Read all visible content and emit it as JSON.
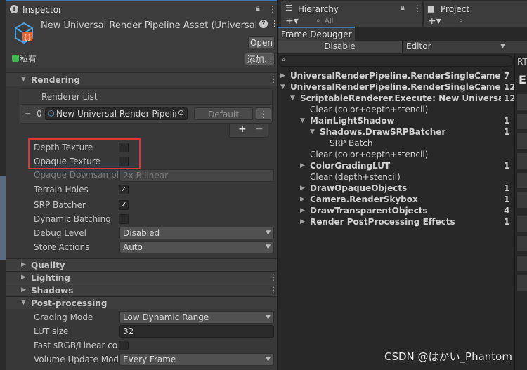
{
  "inspector": {
    "tab_label": "Inspector",
    "asset_title": "New Universal Render Pipeline Asset (Universal",
    "open_button": "Open",
    "private_label": "私有",
    "add_button": "添加...",
    "rendering": {
      "header": "Rendering",
      "renderer_list_label": "Renderer List",
      "renderer_index": "0",
      "renderer_value": "New Universal Render Pipeline",
      "default_button": "Default",
      "plus": "+",
      "minus": "−",
      "rows": [
        {
          "label": "Depth Texture",
          "type": "checkbox",
          "checked": false
        },
        {
          "label": "Opaque Texture",
          "type": "checkbox",
          "checked": false
        },
        {
          "label": "Opaque Downsampli",
          "type": "dropdown-disabled",
          "value": "2x Bilinear"
        },
        {
          "label": "Terrain Holes",
          "type": "checkbox",
          "checked": true
        },
        {
          "label": "SRP Batcher",
          "type": "checkbox",
          "checked": true
        },
        {
          "label": "Dynamic Batching",
          "type": "checkbox",
          "checked": false
        },
        {
          "label": "Debug Level",
          "type": "dropdown",
          "value": "Disabled"
        },
        {
          "label": "Store Actions",
          "type": "dropdown",
          "value": "Auto"
        }
      ]
    },
    "sections": [
      "Quality",
      "Lighting",
      "Shadows"
    ],
    "post": {
      "header": "Post-processing",
      "grading_label": "Grading Mode",
      "grading_value": "Low Dynamic Range",
      "lut_label": "LUT size",
      "lut_value": "32",
      "fast_label": "Fast sRGB/Linear cor",
      "volume_label": "Volume Update Mode",
      "volume_value": "Every Frame"
    }
  },
  "hierarchy": {
    "tab_label": "Hierarchy",
    "search_placeholder": "All"
  },
  "project": {
    "tab_label": "Project"
  },
  "frame_debugger": {
    "tab_label": "Frame Debugger",
    "disable_button": "Disable",
    "target_value": "Editor",
    "rt_label": "RT",
    "tree": [
      {
        "text": "UniversalRenderPipeline.RenderSingleCameraIntern",
        "count": "7",
        "indent": 0,
        "toggle": "▶",
        "bold": true
      },
      {
        "text": "UniversalRenderPipeline.RenderSingleCameraIntern",
        "count": "12",
        "indent": 0,
        "toggle": "▼",
        "bold": true
      },
      {
        "text": "ScriptableRenderer.Execute: New Universal Rend",
        "count": "12",
        "indent": 1,
        "toggle": "▼",
        "bold": true
      },
      {
        "text": "Clear (color+depth+stencil)",
        "count": "",
        "indent": 2,
        "toggle": "",
        "bold": false
      },
      {
        "text": "MainLightShadow",
        "count": "1",
        "indent": 2,
        "toggle": "▼",
        "bold": true
      },
      {
        "text": "Shadows.DrawSRPBatcher",
        "count": "1",
        "indent": 3,
        "toggle": "▼",
        "bold": true
      },
      {
        "text": "SRP Batch",
        "count": "",
        "indent": 4,
        "toggle": "",
        "bold": false
      },
      {
        "text": "Clear (color+depth+stencil)",
        "count": "",
        "indent": 2,
        "toggle": "",
        "bold": false
      },
      {
        "text": "ColorGradingLUT",
        "count": "1",
        "indent": 2,
        "toggle": "▶",
        "bold": true
      },
      {
        "text": "Clear (depth+stencil)",
        "count": "",
        "indent": 2,
        "toggle": "",
        "bold": false
      },
      {
        "text": "DrawOpaqueObjects",
        "count": "1",
        "indent": 2,
        "toggle": "▶",
        "bold": true
      },
      {
        "text": "Camera.RenderSkybox",
        "count": "1",
        "indent": 2,
        "toggle": "▶",
        "bold": true
      },
      {
        "text": "DrawTransparentObjects",
        "count": "4",
        "indent": 2,
        "toggle": "▶",
        "bold": true
      },
      {
        "text": "Render PostProcessing Effects",
        "count": "1",
        "indent": 2,
        "toggle": "▶",
        "bold": true
      }
    ]
  },
  "watermark": "CSDN @はかい_Phantom",
  "colors": {
    "highlight_box": "#e0343b",
    "accent": "#3a79bb",
    "asset_icon": "#4aa3e0"
  }
}
